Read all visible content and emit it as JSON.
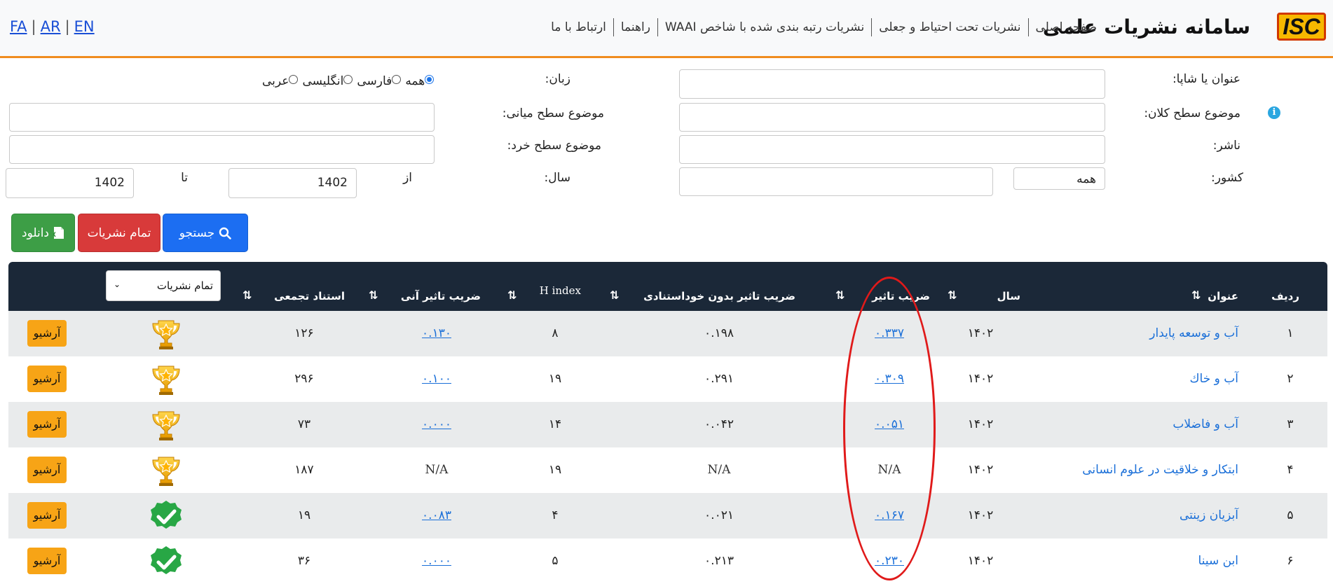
{
  "header": {
    "logo_text": "ISC",
    "site_title": "سامانه نشریات علمی",
    "nav": [
      "صفحه اصلی",
      "نشریات تحت احتیاط و جعلی",
      "نشریات رتبه بندی شده با شاخص WAAI",
      "راهنما",
      "ارتباط با ما"
    ],
    "languages": [
      "FA",
      "AR",
      "EN"
    ],
    "accent_color": "#f08c1e"
  },
  "form": {
    "title_label": "عنوان یا شاپا:",
    "language_label": "زبان:",
    "language_options": [
      "همه",
      "فارسی",
      "انگلیسی",
      "عربی"
    ],
    "language_selected": "همه",
    "macro_subject_label": "موضوع سطح کلان:",
    "mid_subject_label": "موضوع سطح میانی:",
    "publisher_label": "ناشر:",
    "micro_subject_label": "موضوع سطح خرد:",
    "country_label": "کشور:",
    "country_value": "همه",
    "year_label": "سال:",
    "year_from_label": "از",
    "year_to_label": "تا",
    "year_from": "1402",
    "year_to": "1402"
  },
  "buttons": {
    "search": "جستجو",
    "all_journals": "تمام نشریات",
    "download": "دانلود"
  },
  "table": {
    "headers": {
      "row_no": "ردیف",
      "title": "عنوان",
      "year": "سال",
      "impact_factor": "ضریب تاثیر",
      "if_no_self": "ضریب تاثیر بدون خوداستنادی",
      "h_index": "H index",
      "immediacy": "ضریب تاثیر آنی",
      "citations": "استناد تجمعی"
    },
    "filter_select": "تمام نشریات",
    "archive_label": "آرشیو",
    "rows": [
      {
        "no": "۱",
        "title": "آب و توسعه پایدار",
        "year": "۱۴۰۲",
        "if": "۰.۳۳۷",
        "if_ns": "۰.۱۹۸",
        "h": "۸",
        "imm": "۰.۱۳۰",
        "cit": "۱۲۶",
        "badge": "trophy"
      },
      {
        "no": "۲",
        "title": "آب و خاك",
        "year": "۱۴۰۲",
        "if": "۰.۳۰۹",
        "if_ns": "۰.۲۹۱",
        "h": "۱۹",
        "imm": "۰.۱۰۰",
        "cit": "۲۹۶",
        "badge": "trophy"
      },
      {
        "no": "۳",
        "title": "آب و فاضلاب",
        "year": "۱۴۰۲",
        "if": "۰.۰۵۱",
        "if_ns": "۰.۰۴۲",
        "h": "۱۴",
        "imm": "۰.۰۰۰",
        "cit": "۷۳",
        "badge": "trophy"
      },
      {
        "no": "۴",
        "title": "ابتکار و خلاقیت در علوم انسانی",
        "year": "۱۴۰۲",
        "if": "N/A",
        "if_ns": "N/A",
        "h": "۱۹",
        "imm": "N/A",
        "cit": "۱۸۷",
        "badge": "trophy"
      },
      {
        "no": "۵",
        "title": "آبزیان زینتی",
        "year": "۱۴۰۲",
        "if": "۰.۱۶۷",
        "if_ns": "۰.۰۲۱",
        "h": "۴",
        "imm": "۰.۰۸۳",
        "cit": "۱۹",
        "badge": "shield"
      },
      {
        "no": "۶",
        "title": "ابن سینا",
        "year": "۱۴۰۲",
        "if": "۰.۲۳۰",
        "if_ns": "۰.۲۱۳",
        "h": "۵",
        "imm": "۰.۰۰۰",
        "cit": "۳۶",
        "badge": "shield"
      }
    ]
  },
  "annotation_color": "#e01a1a"
}
